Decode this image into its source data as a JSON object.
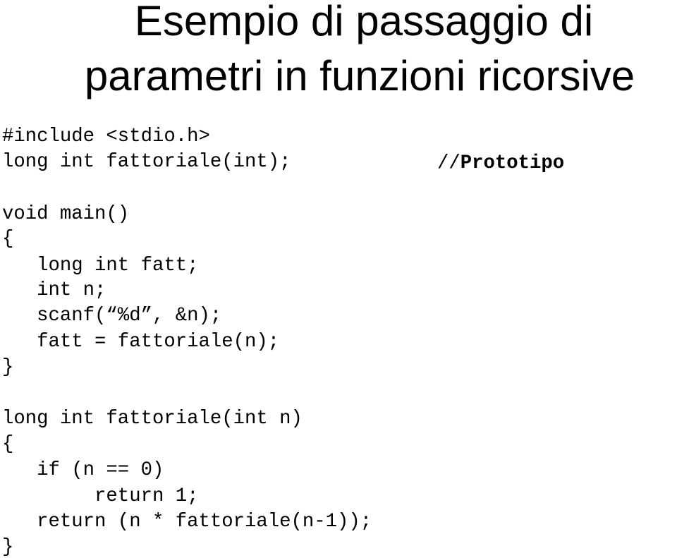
{
  "slide": {
    "title_line1": "Esempio di passaggio di",
    "title_line2": "parametri in funzioni ricorsive",
    "comment_prefix": "//",
    "comment_text": "Prototipo",
    "code_lines": [
      "#include <stdio.h>",
      "long int fattoriale(int);",
      "",
      "void main()",
      "{",
      "   long int fatt;",
      "   int n;",
      "   scanf(“%d”, &n);",
      "   fatt = fattoriale(n);",
      "}",
      "",
      "long int fattoriale(int n)",
      "{",
      "   if (n == 0)",
      "        return 1;",
      "   return (n * fattoriale(n-1));",
      "}"
    ]
  }
}
